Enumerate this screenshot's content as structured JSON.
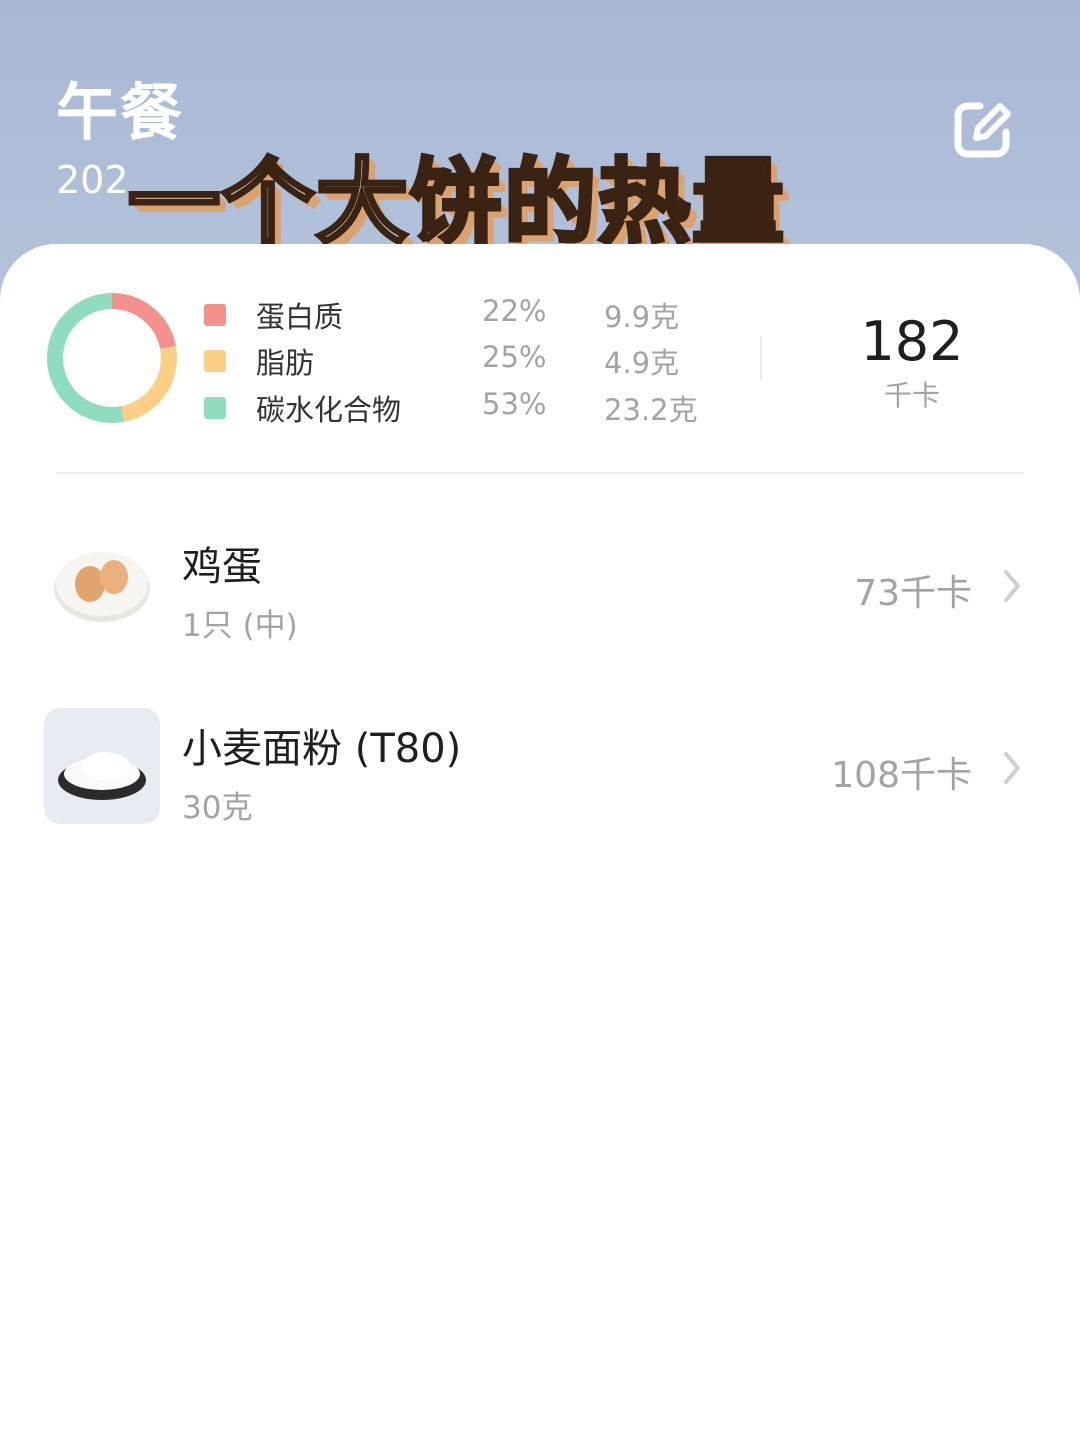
{
  "header": {
    "title": "午餐",
    "date_visible": "202",
    "overlay_caption": "一个大饼的热量"
  },
  "summary": {
    "macros": [
      {
        "name": "蛋白质",
        "percent": "22%",
        "amount": "9.9克",
        "color": "#f4918c",
        "fraction": 0.22
      },
      {
        "name": "脂肪",
        "percent": "25%",
        "amount": "4.9克",
        "color": "#fbcf86",
        "fraction": 0.25
      },
      {
        "name": "碳水化合物",
        "percent": "53%",
        "amount": "23.2克",
        "color": "#8fdcbe",
        "fraction": 0.53
      }
    ],
    "total_value": "182",
    "total_unit": "千卡"
  },
  "foods": [
    {
      "name": "鸡蛋",
      "portion": "1只 (中)",
      "kcal": "73千卡",
      "icon": "egg-plate-photo"
    },
    {
      "name": "小麦面粉 (T80)",
      "portion": "30克",
      "kcal": "108千卡",
      "icon": "flour-bowl-photo"
    }
  ],
  "icons": {
    "edit": "edit-icon",
    "chevron": "chevron-right-icon"
  }
}
